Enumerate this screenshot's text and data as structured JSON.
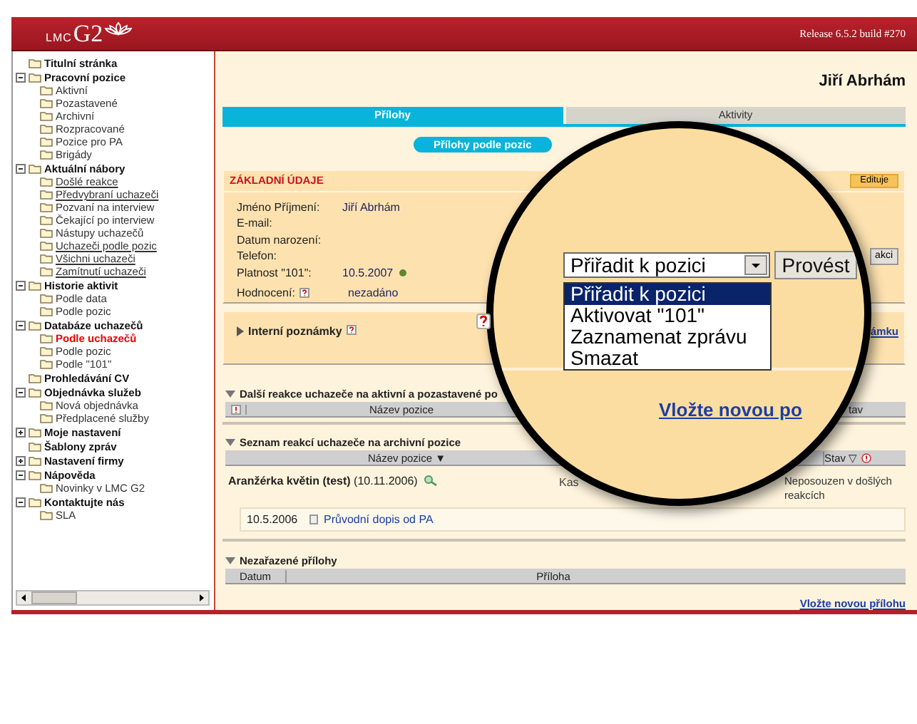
{
  "header": {
    "logo_prefix": "LMC",
    "logo_main": "G2",
    "release": "Release 6.5.2 build #270"
  },
  "sidebar": {
    "items": [
      {
        "label": "Titulní stránka",
        "kind": "plain"
      },
      {
        "label": "Pracovní pozice",
        "kind": "toggle",
        "expanded": true,
        "children": [
          {
            "label": "Aktivní",
            "link": false,
            "selected": false
          },
          {
            "label": "Pozastavené",
            "link": false,
            "selected": false
          },
          {
            "label": "Archivní",
            "link": false,
            "selected": false
          },
          {
            "label": "Rozpracované",
            "link": false,
            "selected": false
          },
          {
            "label": "Pozice pro PA",
            "link": false,
            "selected": false
          },
          {
            "label": "Brigády",
            "link": false,
            "selected": false
          }
        ]
      },
      {
        "label": "Aktuální nábory",
        "kind": "toggle",
        "expanded": true,
        "children": [
          {
            "label": "Došlé reakce",
            "link": true,
            "selected": false
          },
          {
            "label": "Předvybraní uchazeči",
            "link": true,
            "selected": false
          },
          {
            "label": "Pozvaní na interview",
            "link": false,
            "selected": false
          },
          {
            "label": "Čekající po interview",
            "link": false,
            "selected": false
          },
          {
            "label": "Nástupy uchazečů",
            "link": false,
            "selected": false
          },
          {
            "label": "Uchazeči podle pozic",
            "link": true,
            "selected": false
          },
          {
            "label": "Všichni uchazeči",
            "link": true,
            "selected": false
          },
          {
            "label": "Zamítnutí uchazeči",
            "link": true,
            "selected": false
          }
        ]
      },
      {
        "label": "Historie aktivit",
        "kind": "toggle",
        "expanded": true,
        "children": [
          {
            "label": "Podle data",
            "link": false,
            "selected": false
          },
          {
            "label": "Podle pozic",
            "link": false,
            "selected": false
          }
        ]
      },
      {
        "label": "Databáze uchazečů",
        "kind": "toggle",
        "expanded": true,
        "children": [
          {
            "label": "Podle uchazečů",
            "link": false,
            "selected": true
          },
          {
            "label": "Podle pozic",
            "link": false,
            "selected": false
          },
          {
            "label": "Podle \"101\"",
            "link": false,
            "selected": false
          }
        ]
      },
      {
        "label": "Prohledávání CV",
        "kind": "plain"
      },
      {
        "label": "Objednávka služeb",
        "kind": "toggle",
        "expanded": true,
        "children": [
          {
            "label": "Nová objednávka",
            "link": false,
            "selected": false
          },
          {
            "label": "Předplacené služby",
            "link": false,
            "selected": false
          }
        ]
      },
      {
        "label": "Moje nastavení",
        "kind": "toggle",
        "expanded": false
      },
      {
        "label": "Šablony zpráv",
        "kind": "plain"
      },
      {
        "label": "Nastavení firmy",
        "kind": "toggle",
        "expanded": false
      },
      {
        "label": "Nápověda",
        "kind": "toggle",
        "expanded": true,
        "children": [
          {
            "label": "Novinky v LMC G2",
            "link": false,
            "selected": false
          }
        ]
      },
      {
        "label": "Kontaktujte nás",
        "kind": "toggle",
        "expanded": true,
        "children": [
          {
            "label": "SLA",
            "link": false,
            "selected": false
          }
        ]
      }
    ]
  },
  "person_name": "Jiří Abrhám",
  "tabs": [
    {
      "label": "Přílohy",
      "selected": true
    },
    {
      "label": "Aktivity",
      "selected": false
    }
  ],
  "subtab": "Přílohy podle pozic",
  "basic_info": {
    "title": "ZÁKLADNÍ ÚDAJE",
    "edit_button": "Edituje",
    "action_button_fragment": "akci",
    "fields": [
      {
        "label": "Jméno Příjmení:",
        "value": "Jiří Abrhám",
        "help": false,
        "status_dot": false
      },
      {
        "label": "E-mail:",
        "help": false,
        "status_dot": false
      },
      {
        "label": "Datum narození:",
        "help": false,
        "status_dot": false
      },
      {
        "label": "Telefon:",
        "help": false,
        "status_dot": false
      },
      {
        "label": "Platnost \"101\":",
        "value": "10.5.2007",
        "help": false,
        "status_dot": true
      },
      {
        "label": "Hodnocení:",
        "value": "nezadáno",
        "help": true,
        "status_dot": false
      }
    ]
  },
  "notes": {
    "title": "Interní poznámky",
    "expanded": false,
    "link_fragment": "ámku"
  },
  "other_reactions": {
    "title": "Další reakce uchazeče na aktivní a pozastavené po",
    "columns": [
      "Název pozice",
      "tav"
    ]
  },
  "archive_reactions": {
    "title": "Seznam reakcí uchazeče na archivní pozice",
    "columns": [
      "Název pozice ▼",
      "Stav ▽"
    ],
    "rows": [
      {
        "position": "Aranžérka květin (test)",
        "date": "(10.11.2006)",
        "column_2": "Kas",
        "status": "Neposouzen v došlých reakcích",
        "attachments": [
          {
            "date": "10.5.2006",
            "link": "Průvodní dopis od PA"
          }
        ]
      }
    ]
  },
  "unassigned_attachments": {
    "title": "Nezařazené přílohy",
    "columns": [
      "Datum",
      "Příloha"
    ],
    "link": "Vložte novou přílohu"
  },
  "magnifier": {
    "select_value": "Přiřadit k pozici",
    "options": [
      {
        "label": "Přiřadit k pozici",
        "selected": true
      },
      {
        "label": "Aktivovat \"101\"",
        "selected": false
      },
      {
        "label": "Zaznamenat zprávu",
        "selected": false
      },
      {
        "label": "Smazat",
        "selected": false
      }
    ],
    "button": "Provést",
    "link_fragment": "Vložte novou po"
  }
}
